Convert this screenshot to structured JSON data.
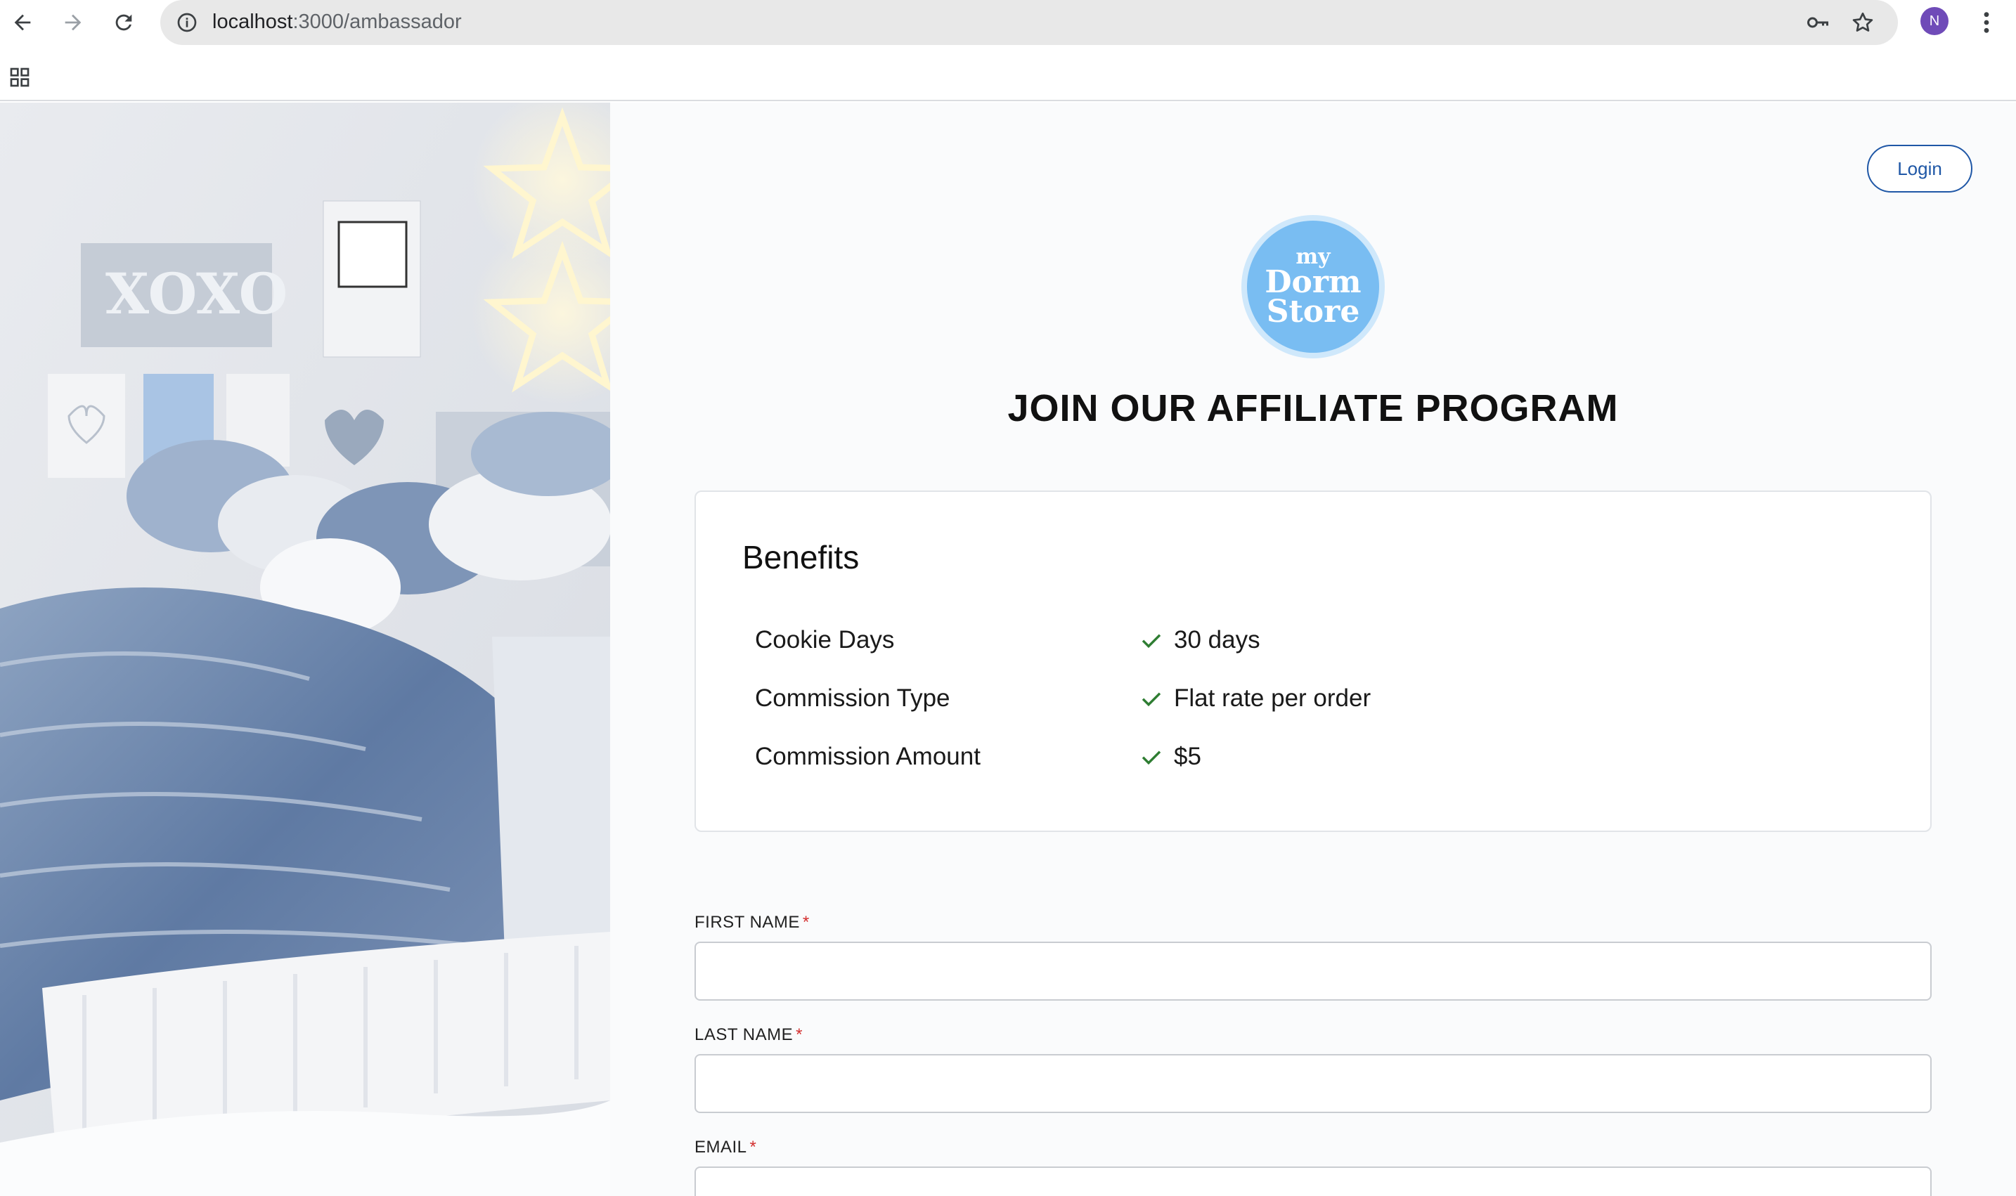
{
  "browser": {
    "url_host": "localhost",
    "url_path": ":3000/ambassador",
    "profile_initial": "N"
  },
  "header": {
    "login_label": "Login"
  },
  "logo": {
    "line1": "my",
    "line2": "Dorm",
    "line3": "Store"
  },
  "title": "JOIN OUR AFFILIATE PROGRAM",
  "benefits": {
    "heading": "Benefits",
    "rows": [
      {
        "label": "Cookie Days",
        "value": "30 days"
      },
      {
        "label": "Commission Type",
        "value": "Flat rate per order"
      },
      {
        "label": "Commission Amount",
        "value": "$5"
      }
    ]
  },
  "form": {
    "first_name_label": "FIRST NAME",
    "last_name_label": "LAST NAME",
    "email_label": "EMAIL",
    "required_mark": "*",
    "first_name_value": "",
    "last_name_value": "",
    "email_value": ""
  },
  "colors": {
    "accent": "#1f57a6",
    "check": "#2e7d32",
    "required": "#d32f2f",
    "logo_blue": "#79bdf2"
  }
}
